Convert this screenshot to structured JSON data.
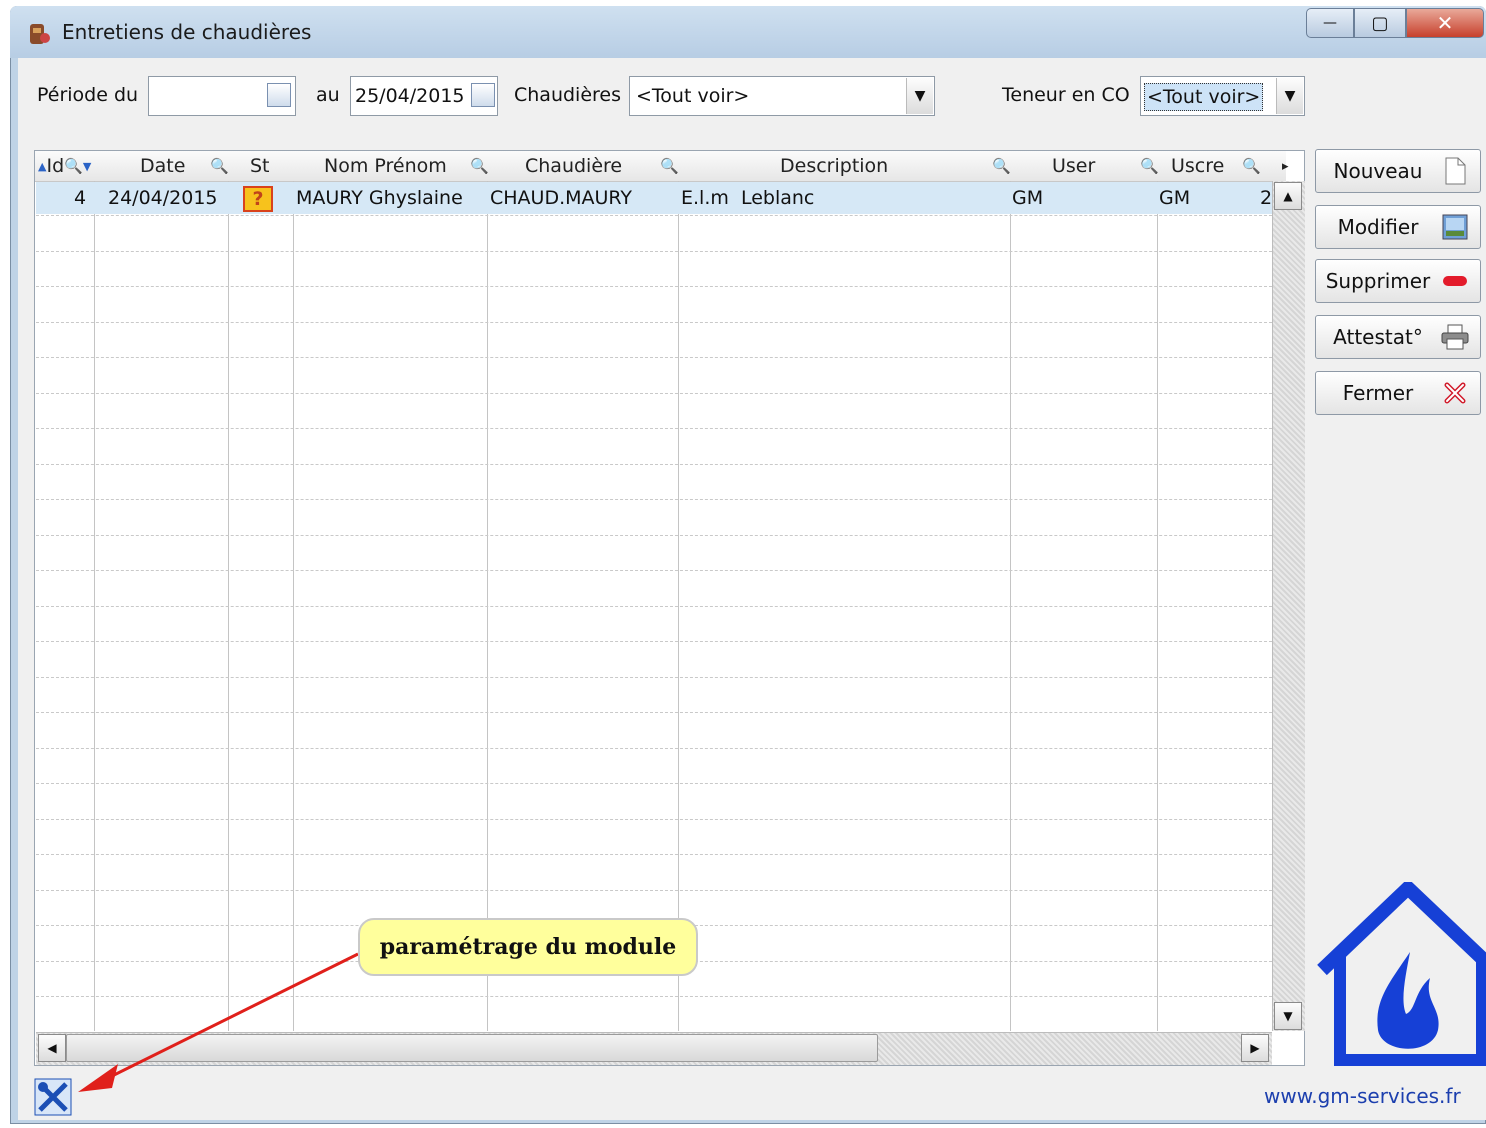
{
  "window": {
    "title": "Entretiens de chaudières",
    "controls": {
      "minimize": "—",
      "maximize": "▢",
      "close": "✕"
    }
  },
  "filters": {
    "period_from_label": "Période du",
    "period_from_value": "",
    "period_to_label": "au",
    "period_to_value": "25/04/2015",
    "boilers_label": "Chaudières",
    "boilers_value": "<Tout voir>",
    "co_label": "Teneur en CO",
    "co_value": "<Tout voir>"
  },
  "grid": {
    "columns": [
      "Id",
      "Date",
      "St",
      "Nom Prénom",
      "Chaudière",
      "Description",
      "User",
      "Uscre"
    ],
    "rows": [
      {
        "id": "4",
        "date": "24/04/2015",
        "status": "?",
        "name": "MAURY Ghyslaine",
        "boiler": "CHAUD.MAURY",
        "description": "E.l.m  Leblanc",
        "user": "GM",
        "uscre": "GM",
        "extra": "2"
      }
    ],
    "scroll": {
      "up": "▲",
      "down": "▼",
      "left": "◀",
      "right": "▶",
      "more": "▸"
    }
  },
  "buttons": {
    "new": "Nouveau",
    "edit": "Modifier",
    "delete": "Supprimer",
    "certificate": "Attestat°",
    "close": "Fermer"
  },
  "callout": "paramétrage du module",
  "footer_url": "www.gm-services.fr",
  "colors": {
    "accent_blue": "#1640d6",
    "callout_bg": "#ffff9c",
    "arrow_red": "#e0201b",
    "selected_row": "#d6e8f6"
  },
  "icons": {
    "app": "boiler-app-icon",
    "settings": "tools-settings-icon",
    "logo": "house-flame-logo"
  }
}
